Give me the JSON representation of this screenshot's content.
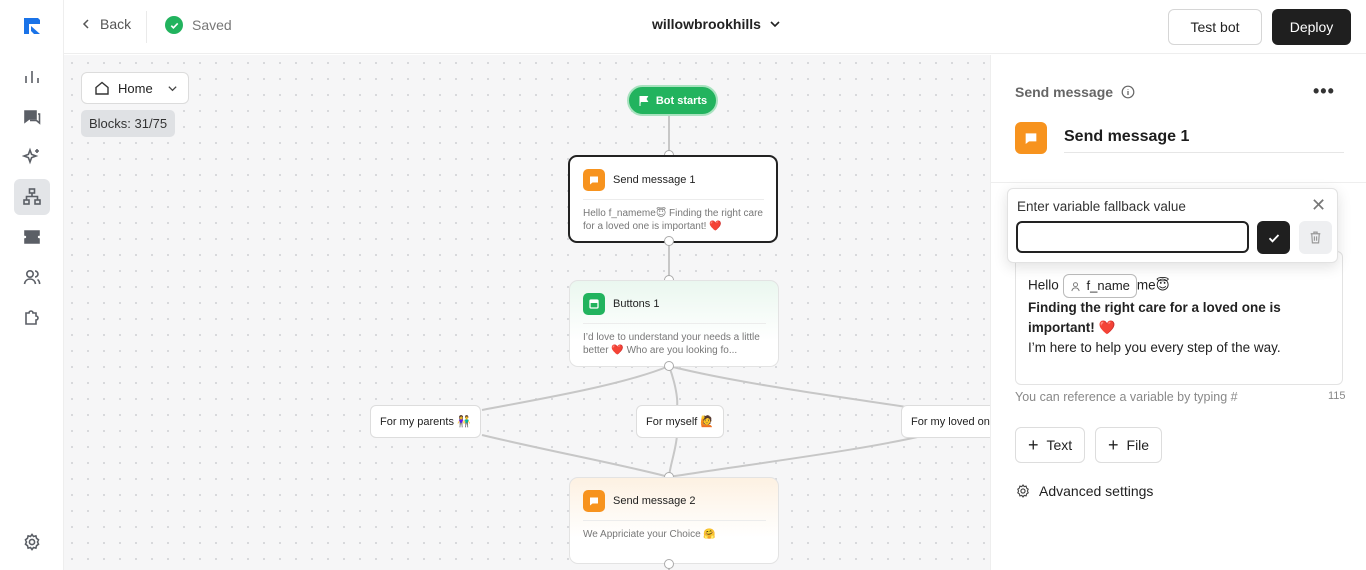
{
  "topbar": {
    "back_label": "Back",
    "saved_label": "Saved",
    "bot_name": "willowbrookhills",
    "test_label": "Test bot",
    "deploy_label": "Deploy"
  },
  "sidebar": {
    "items": [
      {
        "icon": "analytics-icon"
      },
      {
        "icon": "conversations-icon"
      },
      {
        "icon": "ai-sparkle-icon"
      },
      {
        "icon": "flow-builder-icon",
        "active": true
      },
      {
        "icon": "tickets-icon"
      },
      {
        "icon": "contacts-icon"
      },
      {
        "icon": "integrations-icon"
      }
    ],
    "settings_icon": "gear-icon"
  },
  "canvas": {
    "home_label": "Home",
    "blocks_label": "Blocks: 31/75",
    "start_label": "Bot starts",
    "nodes": [
      {
        "title": "Send message 1",
        "body": "Hello f_nameme😇 Finding the right care for a loved one is important! ❤️"
      },
      {
        "title": "Buttons 1",
        "body": "I’d love to understand your needs a little better ❤️ Who are you looking fo..."
      },
      {
        "title": "Send message 2",
        "body": "We Appriciate your Choice 🤗"
      }
    ],
    "choices": [
      "For my parents 👫",
      "For myself 🙋",
      "For my loved one"
    ]
  },
  "panel": {
    "header": "Send message",
    "title": "Send message 1",
    "message": {
      "hello": "Hello",
      "var_name": "f_name",
      "after_var": "me😇",
      "bold_line": "Finding the right care for a loved one is important!",
      "heart": "❤️",
      "last_line": "I’m here to help you every step of the way."
    },
    "hint": "You can reference a variable by typing #",
    "char_count": "115",
    "add_text_label": "Text",
    "add_file_label": "File",
    "advanced_label": "Advanced settings"
  },
  "popover": {
    "label": "Enter variable fallback value",
    "value": ""
  },
  "colors": {
    "accent_green": "#22b35e",
    "message_orange": "#f7931e",
    "dark": "#1f1f1f"
  }
}
